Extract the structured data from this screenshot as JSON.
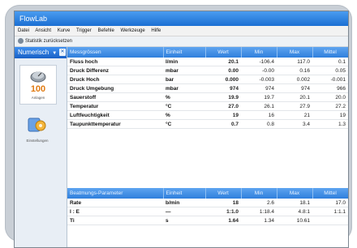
{
  "app": {
    "title": "FlowLab"
  },
  "menu": [
    "Datei",
    "Ansicht",
    "Kurve",
    "Trigger",
    "Befehle",
    "Werkzeuge",
    "Hilfe"
  ],
  "toolbar": {
    "label": "Statistik zurücksetzen"
  },
  "sidebar": {
    "header": "Numerisch",
    "close": "✕",
    "items": [
      {
        "label": "Anlagen",
        "value": "100"
      },
      {
        "label": "Einstellungen"
      }
    ]
  },
  "table1": {
    "headers": [
      "Messgrössen",
      "Einheit",
      "Wert",
      "Min",
      "Max",
      "Mittel"
    ],
    "rows": [
      [
        "Fluss hoch",
        "l/min",
        "20.1",
        "-106.4",
        "117.0",
        "0.1"
      ],
      [
        "Druck Differenz",
        "mbar",
        "0.00",
        "-0.00",
        "0.16",
        "0.05"
      ],
      [
        "Druck Hoch",
        "bar",
        "0.000",
        "-0.003",
        "0.002",
        "-0.001"
      ],
      [
        "Druck Umgebung",
        "mbar",
        "974",
        "974",
        "974",
        "966"
      ],
      [
        "Sauerstoff",
        "%",
        "19.9",
        "19.7",
        "20.1",
        "20.0"
      ],
      [
        "Temperatur",
        "°C",
        "27.0",
        "26.1",
        "27.9",
        "27.2"
      ],
      [
        "Luftfeuchtigkeit",
        "%",
        "19",
        "16",
        "21",
        "19"
      ],
      [
        "Taupunkttemperatur",
        "°C",
        "0.7",
        "0.8",
        "3.4",
        "1.3"
      ]
    ]
  },
  "table2": {
    "headers": [
      "Beatmungs-Parameter",
      "Einheit",
      "Wert",
      "Min",
      "Max",
      "Mittel"
    ],
    "rows": [
      [
        "Rate",
        "b/min",
        "18",
        "2.6",
        "18.1",
        "17.0"
      ],
      [
        "I : E",
        "—",
        "1:1.0",
        "1:18.4",
        "4.8:1",
        "1:1.1"
      ],
      [
        "Ti",
        "s",
        "1.64",
        "1.34",
        "10.61",
        ""
      ]
    ]
  }
}
